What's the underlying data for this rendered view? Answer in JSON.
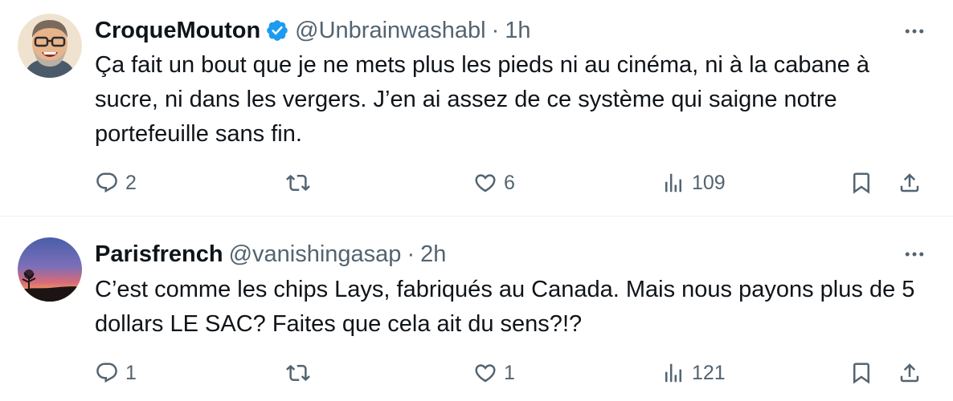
{
  "tweets": [
    {
      "display_name": "CroqueMouton",
      "verified": true,
      "handle": "@Unbrainwashabl",
      "separator": "·",
      "time": "1h",
      "text": "Ça fait un bout que je ne mets plus les pieds ni au cinéma, ni à la cabane à sucre, ni dans les vergers. J’en ai assez de ce système qui saigne notre portefeuille sans fin.",
      "replies": "2",
      "retweets": "",
      "likes": "6",
      "views": "109"
    },
    {
      "display_name": "Parisfrench",
      "verified": false,
      "handle": "@vanishingasap",
      "separator": "·",
      "time": "2h",
      "text": "C’est comme les chips Lays, fabriqués au Canada.  Mais nous payons plus de 5 dollars LE SAC?  Faites que cela ait du sens?!?",
      "replies": "1",
      "retweets": "",
      "likes": "1",
      "views": "121"
    }
  ],
  "colors": {
    "text": "#0f1419",
    "secondary": "#536471",
    "verified": "#1d9bf0",
    "divider": "#eff3f4"
  },
  "icons": [
    "reply-icon",
    "retweet-icon",
    "like-icon",
    "views-icon",
    "bookmark-icon",
    "share-icon",
    "more-icon",
    "verified-badge-icon"
  ]
}
